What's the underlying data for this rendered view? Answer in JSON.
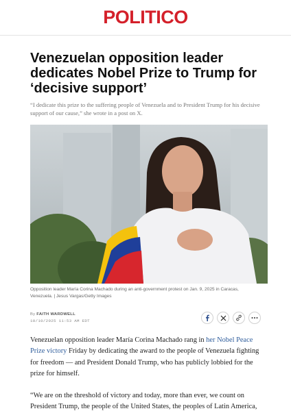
{
  "masthead": {
    "logo": "POLITICO"
  },
  "article": {
    "headline": "Venezuelan opposition leader dedicates Nobel Prize to Trump for ‘decisive support’",
    "dek": "“I dedicate this prize to the suffering people of Venezuela and to President Trump for his decisive support of our cause,” she wrote in a post on X.",
    "photo": {
      "caption": "Opposition leader María Corina Machado during an anti-government protest on Jan. 9, 2025 in Caracas, Venezuela. | Jesus Vargas/Getty Images"
    },
    "byline": {
      "prefix": "By",
      "author": "FAITH WARDWELL",
      "date": "10/10/2025 11:53 AM EDT"
    },
    "share": {
      "icons": [
        "facebook-icon",
        "x-icon",
        "link-icon",
        "more-icon"
      ]
    },
    "body": {
      "p1_before": "Venezuelan opposition leader María Corina Machado rang in ",
      "p1_link": "her Nobel Peace Prize victory",
      "p1_after": " Friday by dedicating the award to the people of Venezuela fighting for freedom — and President Donald Trump, who has publicly lobbied for the prize for himself.",
      "p2": "“We are on the threshold of victory and today, more than ever, we count on President Trump, the people of the United States, the peoples of Latin America,"
    }
  },
  "colors": {
    "brand": "#d4202a",
    "link": "#2f5d9c"
  }
}
